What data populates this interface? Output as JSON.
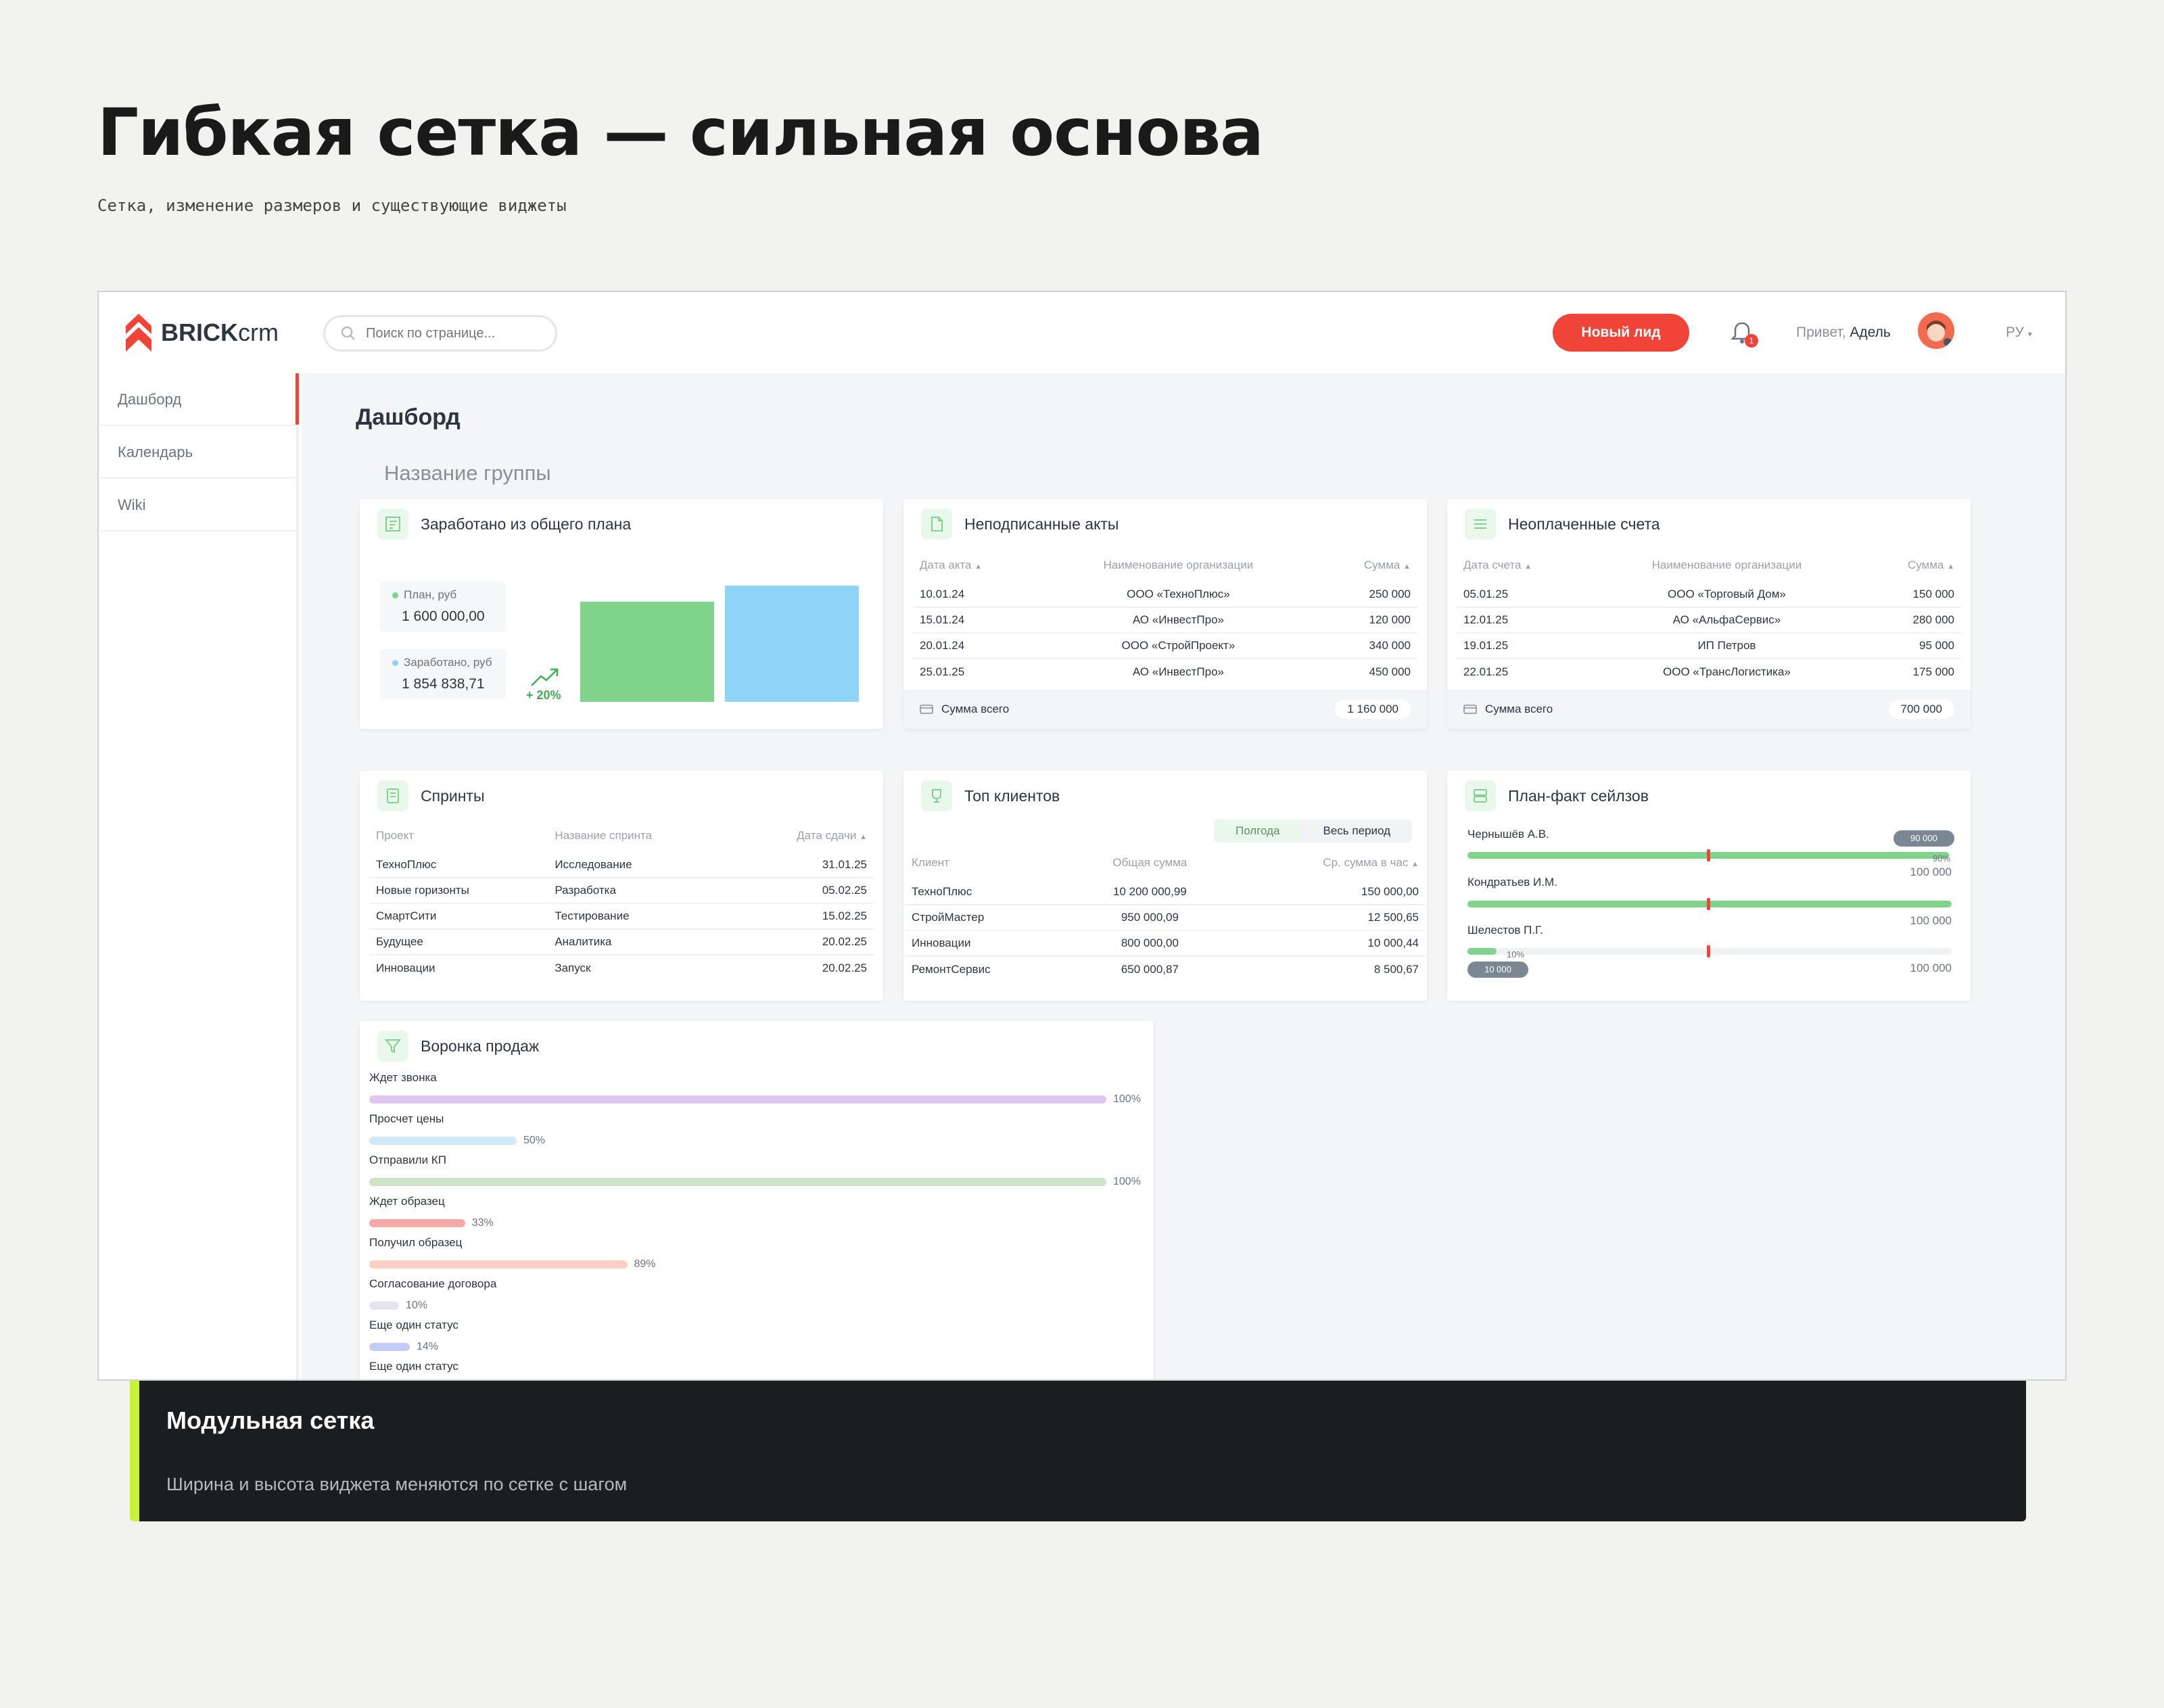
{
  "hero": {
    "title": "Гибкая сетка — сильная основа",
    "subtitle": "Сетка, изменение размеров и существующие виджеты"
  },
  "header": {
    "logo_bold": "BRICK",
    "logo_light": "crm",
    "search_placeholder": "Поиск по странице...",
    "new_lead_label": "Новый лид",
    "bell_badge": "1",
    "greeting_prefix": "Привет,",
    "greeting_name": "Адель",
    "language": "РУ"
  },
  "sidebar": {
    "items": [
      {
        "label": "Дашборд"
      },
      {
        "label": "Календарь"
      },
      {
        "label": "Wiki"
      }
    ]
  },
  "page": {
    "title": "Дашборд",
    "group_title": "Название группы"
  },
  "earned_widget": {
    "title": "Заработано из общего плана",
    "plan_label": "План, руб",
    "plan_value": "1 600 000,00",
    "earned_label": "Заработано, руб",
    "earned_value": "1 854 838,71",
    "growth": "+ 20%",
    "plan_color": "#7fd38b",
    "earned_color": "#8fd4f7"
  },
  "chart_data": {
    "type": "bar",
    "categories": [
      "План, руб",
      "Заработано, руб"
    ],
    "values": [
      1600000,
      1854838.71
    ],
    "ylim": [
      0,
      1900000
    ]
  },
  "acts_widget": {
    "title": "Неподписанные акты",
    "headers": [
      "Дата акта",
      "Наименование организации",
      "Сумма"
    ],
    "rows": [
      [
        "10.01.24",
        "ООО «ТехноПлюс»",
        "250 000"
      ],
      [
        "15.01.24",
        "АО «ИнвестПро»",
        "120 000"
      ],
      [
        "20.01.24",
        "ООО «СтройПроект»",
        "340 000"
      ],
      [
        "25.01.25",
        "АО «ИнвестПро»",
        "450 000"
      ]
    ],
    "total_label": "Сумма всего",
    "total_value": "1 160 000"
  },
  "invoices_widget": {
    "title": "Неоплаченные счета",
    "headers": [
      "Дата счета",
      "Наименование организации",
      "Сумма"
    ],
    "rows": [
      [
        "05.01.25",
        "ООО «Торговый Дом»",
        "150 000"
      ],
      [
        "12.01.25",
        "АО «АльфаСервис»",
        "280 000"
      ],
      [
        "19.01.25",
        "ИП Петров",
        "95 000"
      ],
      [
        "22.01.25",
        "ООО «ТрансЛогистика»",
        "175 000"
      ]
    ],
    "total_label": "Сумма всего",
    "total_value": "700 000"
  },
  "sprints_widget": {
    "title": "Спринты",
    "headers": [
      "Проект",
      "Название спринта",
      "Дата сдачи"
    ],
    "rows": [
      [
        "ТехноПлюс",
        "Исследование",
        "31.01.25"
      ],
      [
        "Новые горизонты",
        "Разработка",
        "05.02.25"
      ],
      [
        "СмартСити",
        "Тестирование",
        "15.02.25"
      ],
      [
        "Будущее",
        "Аналитика",
        "20.02.25"
      ],
      [
        "Инновации",
        "Запуск",
        "20.02.25"
      ]
    ]
  },
  "clients_widget": {
    "title": "Топ клиентов",
    "tab_half": "Полгода",
    "tab_all": "Весь период",
    "headers": [
      "Клиент",
      "Общая сумма",
      "Ср. сумма в час"
    ],
    "rows": [
      [
        "ТехноПлюс",
        "10 200 000,99",
        "150 000,00"
      ],
      [
        "СтройМастер",
        "950 000,09",
        "12 500,65"
      ],
      [
        "Инновации",
        "800 000,00",
        "10 000,44"
      ],
      [
        "РемонтСервис",
        "650 000,87",
        "8 500,67"
      ]
    ]
  },
  "planfact_widget": {
    "title": "План-факт сейлзов",
    "rows": [
      {
        "name": "Чернышёв А.В.",
        "max": "100 000",
        "pill": "90 000",
        "pct_label": "90%",
        "fill": 0.995
      },
      {
        "name": "Кондратьев И.М.",
        "max": "100 000",
        "fill": 1.0
      },
      {
        "name": "Шелестов П.Г.",
        "max": "100 000",
        "pill": "10 000",
        "pct_label": "10%",
        "fill": 0.06
      }
    ]
  },
  "funnel_widget": {
    "title": "Воронка продаж",
    "rows": [
      {
        "label": "Ждет звонка",
        "pct": "100%",
        "value": 1.0,
        "color": "#e2c6f2"
      },
      {
        "label": "Просчет цены",
        "pct": "50%",
        "value": 0.2,
        "color": "#cfe9f8"
      },
      {
        "label": "Отправили КП",
        "pct": "100%",
        "value": 1.0,
        "color": "#cde3c8"
      },
      {
        "label": "Ждет образец",
        "pct": "33%",
        "value": 0.13,
        "color": "#f6a9a5"
      },
      {
        "label": "Получил образец",
        "pct": "89%",
        "value": 0.35,
        "color": "#fbcfc2"
      },
      {
        "label": "Согласование договора",
        "pct": "10%",
        "value": 0.04,
        "color": "#e4e5f1"
      },
      {
        "label": "Еще один статус",
        "pct": "14%",
        "value": 0.055,
        "color": "#c4cdf6"
      },
      {
        "label": "Еще один статус",
        "pct": "",
        "value": 0,
        "color": "#e4e5f1"
      }
    ]
  },
  "caption": {
    "title": "Модульная сетка",
    "text": "Ширина и высота виджета меняются по сетке с шагом"
  }
}
